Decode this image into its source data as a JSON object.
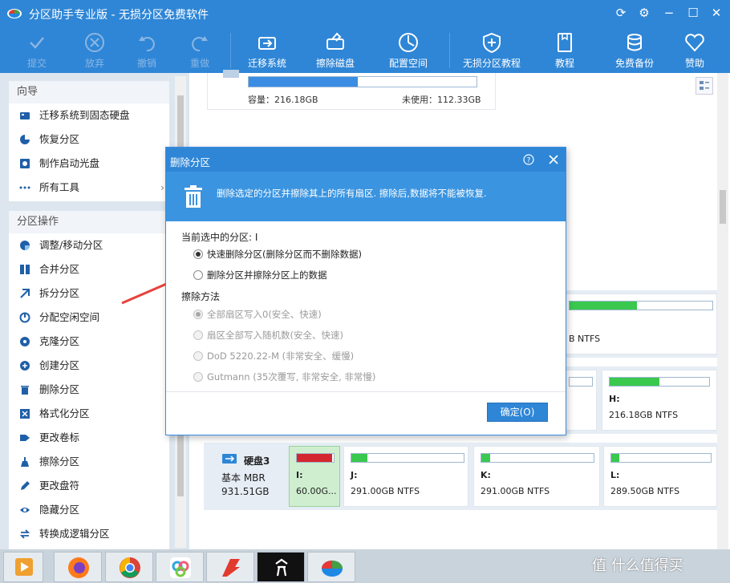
{
  "window": {
    "title": "分区助手专业版 - 无损分区免费软件",
    "controls": [
      "refresh-icon",
      "gear-icon",
      "minimize-icon",
      "maximize-icon",
      "close-icon"
    ]
  },
  "toolbar": {
    "items": [
      {
        "label": "提交",
        "icon": "check-icon",
        "enabled": false
      },
      {
        "label": "放弃",
        "icon": "cancel-icon",
        "enabled": false
      },
      {
        "label": "撤销",
        "icon": "undo-icon",
        "enabled": false
      },
      {
        "label": "重做",
        "icon": "redo-icon",
        "enabled": false
      },
      {
        "label": "迁移系统",
        "icon": "migrate-os-icon",
        "enabled": true
      },
      {
        "label": "擦除磁盘",
        "icon": "wipe-disk-icon",
        "enabled": true
      },
      {
        "label": "配置空间",
        "icon": "clock-icon",
        "enabled": true
      },
      {
        "label": "无损分区教程",
        "icon": "shield-icon",
        "enabled": true
      },
      {
        "label": "教程",
        "icon": "book-icon",
        "enabled": true
      },
      {
        "label": "免费备份",
        "icon": "backup-icon",
        "enabled": true
      },
      {
        "label": "赞助",
        "icon": "heart-icon",
        "enabled": true
      }
    ]
  },
  "sidebar": {
    "wizard": {
      "title": "向导",
      "items": [
        {
          "label": "迁移系统到固态硬盘",
          "icon": "ssd-icon"
        },
        {
          "label": "恢复分区",
          "icon": "pie-icon"
        },
        {
          "label": "制作启动光盘",
          "icon": "disc-icon"
        },
        {
          "label": "所有工具",
          "icon": "more-icon",
          "arrow": "›"
        }
      ]
    },
    "partition_ops": {
      "title": "分区操作",
      "items": [
        {
          "label": "调整/移动分区",
          "icon": "resize-icon"
        },
        {
          "label": "合并分区",
          "icon": "merge-icon"
        },
        {
          "label": "拆分分区",
          "icon": "split-icon"
        },
        {
          "label": "分配空闲空间",
          "icon": "allocate-icon"
        },
        {
          "label": "克隆分区",
          "icon": "clone-icon"
        },
        {
          "label": "创建分区",
          "icon": "create-icon"
        },
        {
          "label": "删除分区",
          "icon": "trash-icon"
        },
        {
          "label": "格式化分区",
          "icon": "format-icon"
        },
        {
          "label": "更改卷标",
          "icon": "tag-icon"
        },
        {
          "label": "擦除分区",
          "icon": "eraser-icon"
        },
        {
          "label": "更改盘符",
          "icon": "edit-icon"
        },
        {
          "label": "隐藏分区",
          "icon": "hide-icon"
        },
        {
          "label": "转换成逻辑分区",
          "icon": "convert-icon"
        }
      ]
    }
  },
  "main": {
    "summary": {
      "capacity_label": "容量：216.18GB",
      "free_label": "未使用：112.33GB",
      "used_fraction": 0.48
    },
    "disk_rows": [
      {
        "partitions": [
          {
            "label": "",
            "size": "B NTFS",
            "fill": 0.47,
            "color": "#3bc84f"
          }
        ]
      },
      {
        "partitions": [
          {
            "label": "",
            "size": "",
            "fill": 0,
            "color": "#3bc84f"
          },
          {
            "label": "H:",
            "size": "216.18GB NTFS",
            "fill": 0.5,
            "color": "#3bc84f"
          }
        ]
      },
      {
        "disk": {
          "name": "硬盘3",
          "type": "基本 MBR",
          "size": "931.51GB"
        },
        "partitions": [
          {
            "label": "I:",
            "size": "60.00G...",
            "fill": 0.95,
            "color": "#d4262e",
            "selected": true
          },
          {
            "label": "J:",
            "size": "291.00GB NTFS",
            "fill": 0.14,
            "color": "#3bc84f"
          },
          {
            "label": "K:",
            "size": "291.00GB NTFS",
            "fill": 0.08,
            "color": "#3bc84f"
          },
          {
            "label": "L:",
            "size": "289.50GB NTFS",
            "fill": 0.08,
            "color": "#3bc84f"
          }
        ]
      }
    ]
  },
  "dialog": {
    "title": "删除分区",
    "help_icon": "help-icon",
    "close_icon": "close-icon",
    "banner_icon": "trash-icon",
    "banner_text": "删除选定的分区并擦除其上的所有扇区. 擦除后,数据将不能被恢复.",
    "current_label": "当前选中的分区: I",
    "options": [
      {
        "label": "快速删除分区(删除分区而不删除数据)",
        "checked": true,
        "enabled": true
      },
      {
        "label": "删除分区并擦除分区上的数据",
        "checked": false,
        "enabled": true
      }
    ],
    "wipe_method_label": "擦除方法",
    "wipe_methods": [
      {
        "label": "全部扇区写入0(安全、快速)",
        "checked": true,
        "enabled": false
      },
      {
        "label": "扇区全部写入随机数(安全、快速)",
        "checked": false,
        "enabled": false
      },
      {
        "label": "DoD 5220.22-M (非常安全、缓慢)",
        "checked": false,
        "enabled": false
      },
      {
        "label": "Gutmann (35次覆写, 非常安全, 非常慢)",
        "checked": false,
        "enabled": false
      }
    ],
    "ok_label": "确定(O)"
  },
  "annotation": {
    "color": "#e8413c"
  },
  "taskbar": {
    "apps": [
      "media-player-icon",
      "firefox-icon",
      "chrome-icon",
      "bird-icon",
      "foxit-icon",
      "jie-icon",
      "partition-assistant-icon"
    ],
    "watermark": "值 什么值得买"
  },
  "colors": {
    "accent": "#2f86d6",
    "used": "#3a8de2",
    "ok": "#3bc84f",
    "selected": "#d4262e"
  }
}
